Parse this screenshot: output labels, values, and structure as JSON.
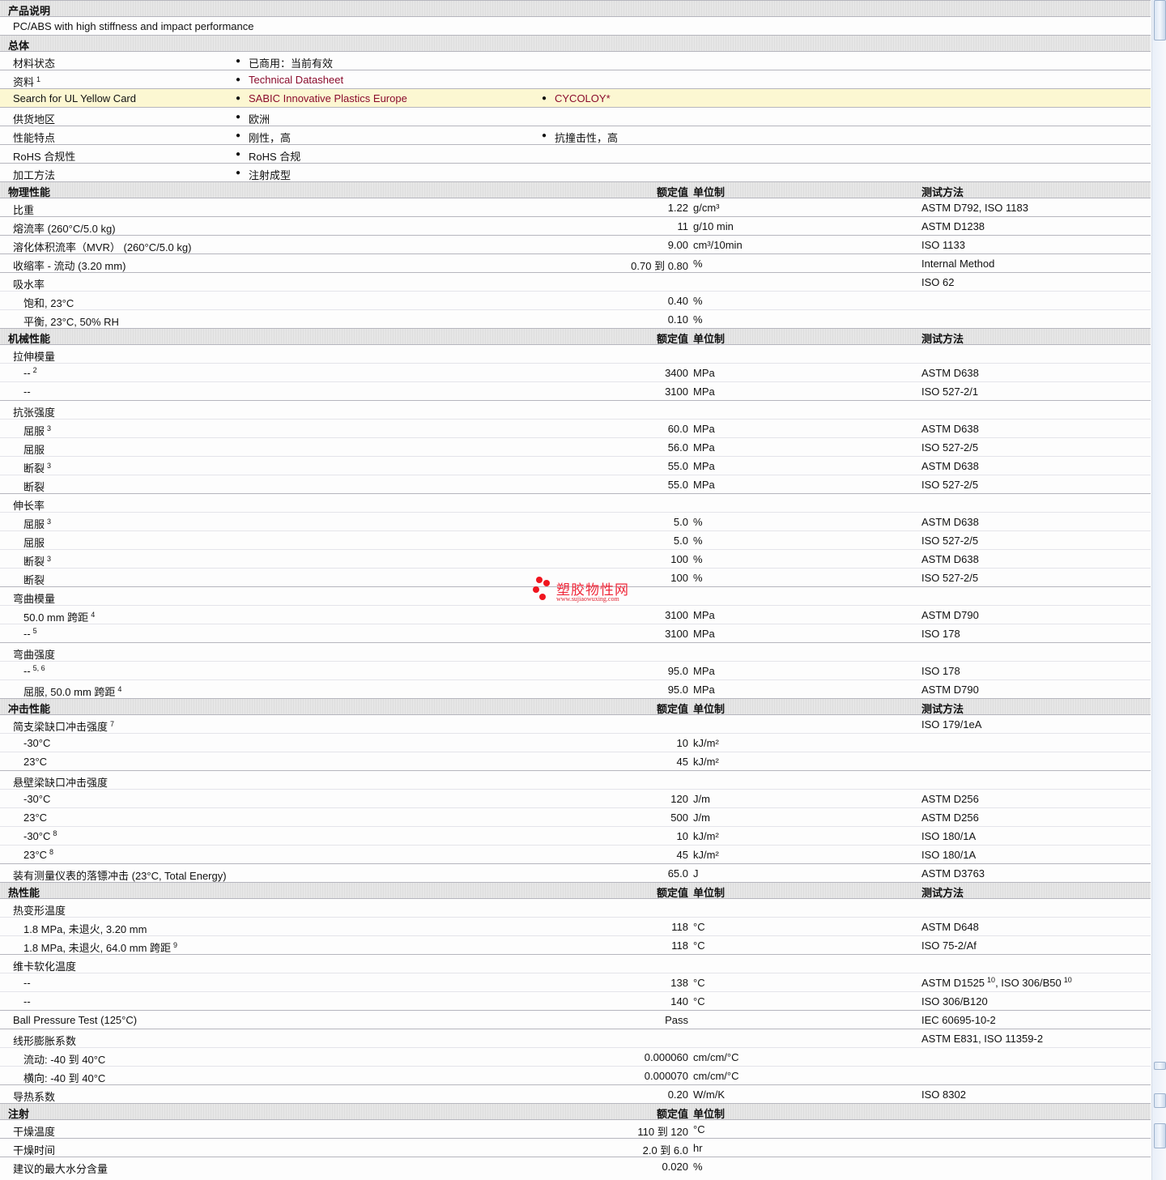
{
  "intro": {
    "section": "产品说明",
    "description": "PC/ABS with high stiffness and impact performance"
  },
  "general": {
    "section": "总体",
    "rows": [
      {
        "label": "材料状态",
        "col2": [
          {
            "text": "已商用：当前有效"
          }
        ],
        "col3": []
      },
      {
        "label": "资料",
        "sup": "1",
        "col2": [
          {
            "text": "Technical Datasheet",
            "link": true
          }
        ],
        "col3": []
      },
      {
        "label": "Search for UL Yellow Card",
        "highlight": true,
        "col2": [
          {
            "text": "SABIC Innovative Plastics Europe",
            "link": true
          }
        ],
        "col3": [
          {
            "text": "CYCOLOY*",
            "link": true
          }
        ]
      },
      {
        "label": "供货地区",
        "col2": [
          {
            "text": "欧洲"
          }
        ],
        "col3": []
      },
      {
        "label": "性能特点",
        "col2": [
          {
            "text": "刚性，高"
          }
        ],
        "col3": [
          {
            "text": "抗撞击性，高"
          }
        ]
      },
      {
        "label": "RoHS 合规性",
        "col2": [
          {
            "text": "RoHS 合规"
          }
        ],
        "col3": []
      },
      {
        "label": "加工方法",
        "col2": [
          {
            "text": "注射成型"
          }
        ],
        "col3": []
      }
    ]
  },
  "colors": {
    "link": "#8a0b2c",
    "highlight": "#fcf7d2",
    "section_bg": "#e3e3e3"
  },
  "sections": [
    {
      "title": "物理性能",
      "h_value": "额定值",
      "h_unit": "单位制",
      "h_method": "测试方法",
      "rows": [
        {
          "label": "比重",
          "value": "1.22",
          "unit": "g/cm³",
          "method": [
            {
              "t": "ASTM D792, ISO 1183"
            }
          ]
        },
        {
          "label": "熔流率  (260°C/5.0 kg)",
          "value": "11",
          "unit": "g/10 min",
          "method": [
            {
              "t": "ASTM D1238"
            }
          ]
        },
        {
          "label": "溶化体积流率（MVR）  (260°C/5.0 kg)",
          "value": "9.00",
          "unit": "cm³/10min",
          "method": [
            {
              "t": "ISO 1133"
            }
          ]
        },
        {
          "label": "收缩率  - 流动  (3.20 mm)",
          "value": "0.70 到  0.80",
          "unit": "%",
          "method": [
            {
              "t": "Internal Method"
            }
          ]
        },
        {
          "label": "吸水率",
          "method": [
            {
              "t": "ISO 62"
            }
          ]
        },
        {
          "label": "饱和, 23°C",
          "sub": true,
          "value": "0.40",
          "unit": "%"
        },
        {
          "label": "平衡, 23°C, 50% RH",
          "sub": true,
          "value": "0.10",
          "unit": "%"
        }
      ]
    },
    {
      "title": "机械性能",
      "h_value": "额定值",
      "h_unit": "单位制",
      "h_method": "测试方法",
      "rows": [
        {
          "label": "拉伸模量"
        },
        {
          "label": "--",
          "sup": "2",
          "sub": true,
          "value": "3400",
          "unit": "MPa",
          "method": [
            {
              "t": "ASTM D638"
            }
          ]
        },
        {
          "label": "--",
          "sub": true,
          "value": "3100",
          "unit": "MPa",
          "method": [
            {
              "t": "ISO 527-2/1"
            }
          ]
        },
        {
          "label": "抗张强度"
        },
        {
          "label": "屈服",
          "sup": "3",
          "sub": true,
          "value": "60.0",
          "unit": "MPa",
          "method": [
            {
              "t": "ASTM D638"
            }
          ]
        },
        {
          "label": "屈服",
          "sub": true,
          "value": "56.0",
          "unit": "MPa",
          "method": [
            {
              "t": "ISO 527-2/5"
            }
          ]
        },
        {
          "label": "断裂",
          "sup": "3",
          "sub": true,
          "value": "55.0",
          "unit": "MPa",
          "method": [
            {
              "t": "ASTM D638"
            }
          ]
        },
        {
          "label": "断裂",
          "sub": true,
          "value": "55.0",
          "unit": "MPa",
          "method": [
            {
              "t": "ISO 527-2/5"
            }
          ]
        },
        {
          "label": "伸长率"
        },
        {
          "label": "屈服",
          "sup": "3",
          "sub": true,
          "value": "5.0",
          "unit": "%",
          "method": [
            {
              "t": "ASTM D638"
            }
          ]
        },
        {
          "label": "屈服",
          "sub": true,
          "value": "5.0",
          "unit": "%",
          "method": [
            {
              "t": "ISO 527-2/5"
            }
          ]
        },
        {
          "label": "断裂",
          "sup": "3",
          "sub": true,
          "value": "100",
          "unit": "%",
          "method": [
            {
              "t": "ASTM D638"
            }
          ]
        },
        {
          "label": "断裂",
          "sub": true,
          "value": "100",
          "unit": "%",
          "method": [
            {
              "t": "ISO 527-2/5"
            }
          ]
        },
        {
          "label": "弯曲模量"
        },
        {
          "label": "50.0 mm 跨距",
          "sup": "4",
          "sub": true,
          "value": "3100",
          "unit": "MPa",
          "method": [
            {
              "t": "ASTM D790"
            }
          ]
        },
        {
          "label": "--",
          "sup": "5",
          "sub": true,
          "value": "3100",
          "unit": "MPa",
          "method": [
            {
              "t": "ISO 178"
            }
          ]
        },
        {
          "label": "弯曲强度"
        },
        {
          "label": "--",
          "sup": "5, 6",
          "sub": true,
          "value": "95.0",
          "unit": "MPa",
          "method": [
            {
              "t": "ISO 178"
            }
          ]
        },
        {
          "label": "屈服, 50.0 mm 跨距",
          "sup": "4",
          "sub": true,
          "value": "95.0",
          "unit": "MPa",
          "method": [
            {
              "t": "ASTM D790"
            }
          ]
        }
      ]
    },
    {
      "title": "冲击性能",
      "h_value": "额定值",
      "h_unit": "单位制",
      "h_method": "测试方法",
      "rows": [
        {
          "label": "简支梁缺口冲击强度",
          "sup": "7",
          "method": [
            {
              "t": "ISO 179/1eA"
            }
          ]
        },
        {
          "label": "-30°C",
          "sub": true,
          "value": "10",
          "unit": "kJ/m²"
        },
        {
          "label": "23°C",
          "sub": true,
          "value": "45",
          "unit": "kJ/m²"
        },
        {
          "label": "悬壁梁缺口冲击强度"
        },
        {
          "label": "-30°C",
          "sub": true,
          "value": "120",
          "unit": "J/m",
          "method": [
            {
              "t": "ASTM D256"
            }
          ]
        },
        {
          "label": "23°C",
          "sub": true,
          "value": "500",
          "unit": "J/m",
          "method": [
            {
              "t": "ASTM D256"
            }
          ]
        },
        {
          "label": "-30°C",
          "sup": "8",
          "sub": true,
          "value": "10",
          "unit": "kJ/m²",
          "method": [
            {
              "t": "ISO 180/1A"
            }
          ]
        },
        {
          "label": "23°C",
          "sup": "8",
          "sub": true,
          "value": "45",
          "unit": "kJ/m²",
          "method": [
            {
              "t": "ISO 180/1A"
            }
          ]
        },
        {
          "label": "装有测量仪表的落镖冲击  (23°C, Total Energy)",
          "value": "65.0",
          "unit": "J",
          "method": [
            {
              "t": "ASTM D3763"
            }
          ]
        }
      ]
    },
    {
      "title": "热性能",
      "h_value": "额定值",
      "h_unit": "单位制",
      "h_method": "测试方法",
      "rows": [
        {
          "label": "热变形温度"
        },
        {
          "label": "1.8 MPa, 未退火, 3.20 mm",
          "sub": true,
          "value": "118",
          "unit": "°C",
          "method": [
            {
              "t": "ASTM D648"
            }
          ]
        },
        {
          "label": "1.8 MPa, 未退火, 64.0 mm 跨距",
          "sup": "9",
          "sub": true,
          "value": "118",
          "unit": "°C",
          "method": [
            {
              "t": "ISO 75-2/Af"
            }
          ]
        },
        {
          "label": "维卡软化温度"
        },
        {
          "label": "--",
          "sub": true,
          "value": "138",
          "unit": "°C",
          "method": [
            {
              "t": "ASTM D1525",
              "sup": "10"
            },
            {
              "t": ", ISO 306/B50",
              "sup": "10"
            }
          ]
        },
        {
          "label": "--",
          "sub": true,
          "value": "140",
          "unit": "°C",
          "method": [
            {
              "t": "ISO 306/B120"
            }
          ]
        },
        {
          "label": "Ball Pressure Test (125°C)",
          "value": "Pass",
          "method": [
            {
              "t": "IEC 60695-10-2"
            }
          ]
        },
        {
          "label": "线形膨胀系数",
          "method": [
            {
              "t": "ASTM E831, ISO 11359-2"
            }
          ]
        },
        {
          "label": "流动: -40 到  40°C",
          "sub": true,
          "value": "0.000060",
          "unit": "cm/cm/°C"
        },
        {
          "label": "横向: -40 到  40°C",
          "sub": true,
          "value": "0.000070",
          "unit": "cm/cm/°C"
        },
        {
          "label": "导热系数",
          "value": "0.20",
          "unit": "W/m/K",
          "method": [
            {
              "t": "ISO 8302"
            }
          ]
        }
      ]
    },
    {
      "title": "注射",
      "h_value": "额定值",
      "h_unit": "单位制",
      "rows": [
        {
          "label": "干燥温度",
          "value": "110 到  120",
          "unit": "°C"
        },
        {
          "label": "干燥时间",
          "value": "2.0 到  6.0",
          "unit": "hr"
        },
        {
          "label": "建议的最大水分含量",
          "value": "0.020",
          "unit": "%"
        }
      ]
    }
  ],
  "watermark": {
    "name": "塑胶物性网",
    "url": "www.sujiaowuxing.com"
  }
}
